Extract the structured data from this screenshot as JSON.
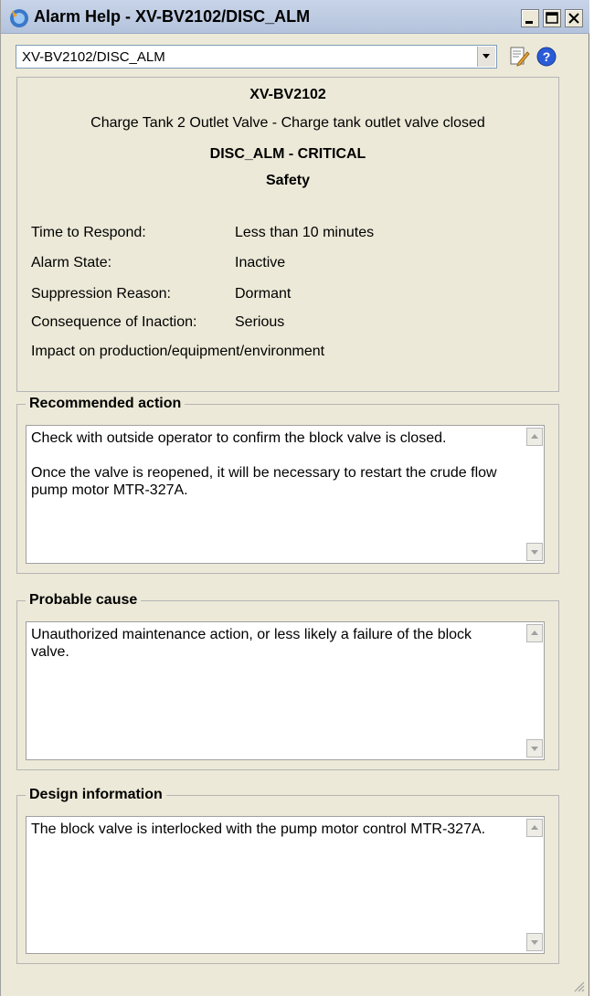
{
  "window": {
    "title": "Alarm Help - XV-BV2102/DISC_ALM",
    "icons": [
      "app-icon",
      "minimize-icon",
      "maximize-icon",
      "close-icon"
    ]
  },
  "toolbar": {
    "alarm_select_value": "XV-BV2102/DISC_ALM",
    "icons": [
      "chevron-down-icon",
      "edit-notes-icon",
      "help-icon"
    ]
  },
  "header": {
    "tag": "XV-BV2102",
    "description": "Charge Tank 2 Outlet Valve - Charge tank outlet valve closed",
    "alarm_line": "DISC_ALM - CRITICAL",
    "category": "Safety"
  },
  "info": {
    "time_to_respond": {
      "label": "Time to Respond:",
      "value": "Less than 10 minutes"
    },
    "alarm_state": {
      "label": "Alarm State:",
      "value": "Inactive"
    },
    "suppression_reason": {
      "label": "Suppression Reason:",
      "value": "Dormant"
    },
    "consequence": {
      "label": "Consequence of Inaction:",
      "value": "Serious"
    },
    "impact": "Impact on production/equipment/environment"
  },
  "recommended_action": {
    "title": "Recommended action",
    "paragraphs": [
      "Check with outside operator to confirm the block valve is closed.",
      "Once the valve is reopened, it will be necessary to restart the crude flow pump motor MTR-327A."
    ]
  },
  "probable_cause": {
    "title": "Probable cause",
    "text": "Unauthorized maintenance action, or less likely a failure of the block valve."
  },
  "design_information": {
    "title": "Design information",
    "text": "The block valve is interlocked with the pump motor control MTR-327A."
  },
  "colors": {
    "window_bg": "#ece9d8",
    "titlebar": "#b4c3dc",
    "text_area_bg": "#ffffff",
    "help_icon_blue": "#2a5bd7"
  }
}
